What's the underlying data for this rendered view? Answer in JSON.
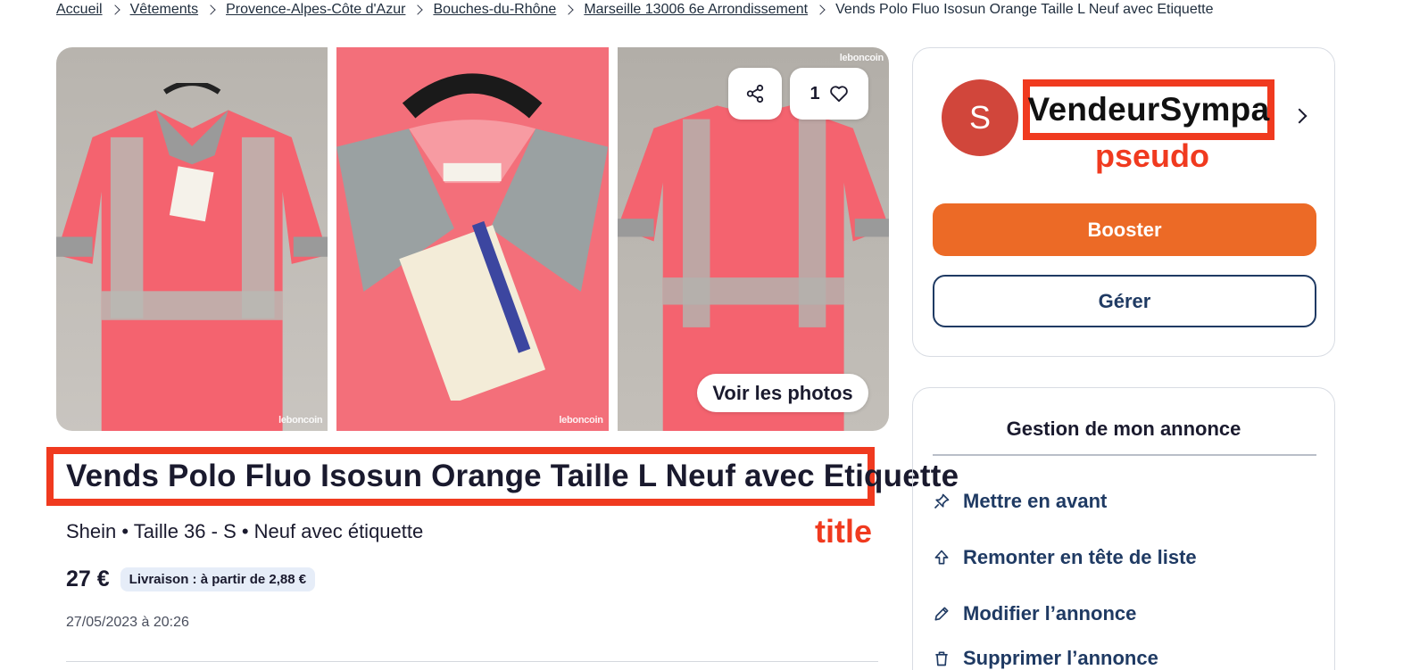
{
  "breadcrumb": {
    "items": [
      "Accueil",
      "Vêtements",
      "Provence-Alpes-Côte d'Azur",
      "Bouches-du-Rhône",
      "Marseille 13006 6e Arrondissement"
    ],
    "current": "Vends Polo Fluo Isosun Orange Taille L Neuf avec Etiquette"
  },
  "gallery": {
    "watermark": "leboncoin",
    "favorites_count": "1",
    "view_photos_label": "Voir les photos",
    "icons": {
      "share": "share-icon",
      "favorite": "heart-icon"
    }
  },
  "listing": {
    "title": "Vends Polo Fluo Isosun Orange Taille L Neuf avec Etiquette",
    "title_annotation": "title",
    "attributes": "Shein • Taille 36 - S • Neuf avec étiquette",
    "price": "27 €",
    "delivery": "Livraison : à partir de 2,88 €",
    "date": "27/05/2023 à 20:26"
  },
  "seller": {
    "initial": "S",
    "name": "VendeurSympa",
    "name_annotation": "pseudo",
    "booster_label": "Booster",
    "gerer_label": "Gérer"
  },
  "manage": {
    "title": "Gestion de mon annonce",
    "items": [
      {
        "label": "Mettre en avant",
        "icon": "pin-icon"
      },
      {
        "label": "Remonter en tête de liste",
        "icon": "arrow-up-icon"
      },
      {
        "label": "Modifier l’annonce",
        "icon": "pencil-icon"
      },
      {
        "label": "Supprimer l’annonce",
        "icon": "trash-icon"
      }
    ]
  },
  "colors": {
    "annotation_red": "#f03a1f",
    "booster_orange": "#ec6a26",
    "navy": "#1f3a63",
    "shirt_pink": "#f36f7a",
    "avatar_red": "#d1463b"
  }
}
